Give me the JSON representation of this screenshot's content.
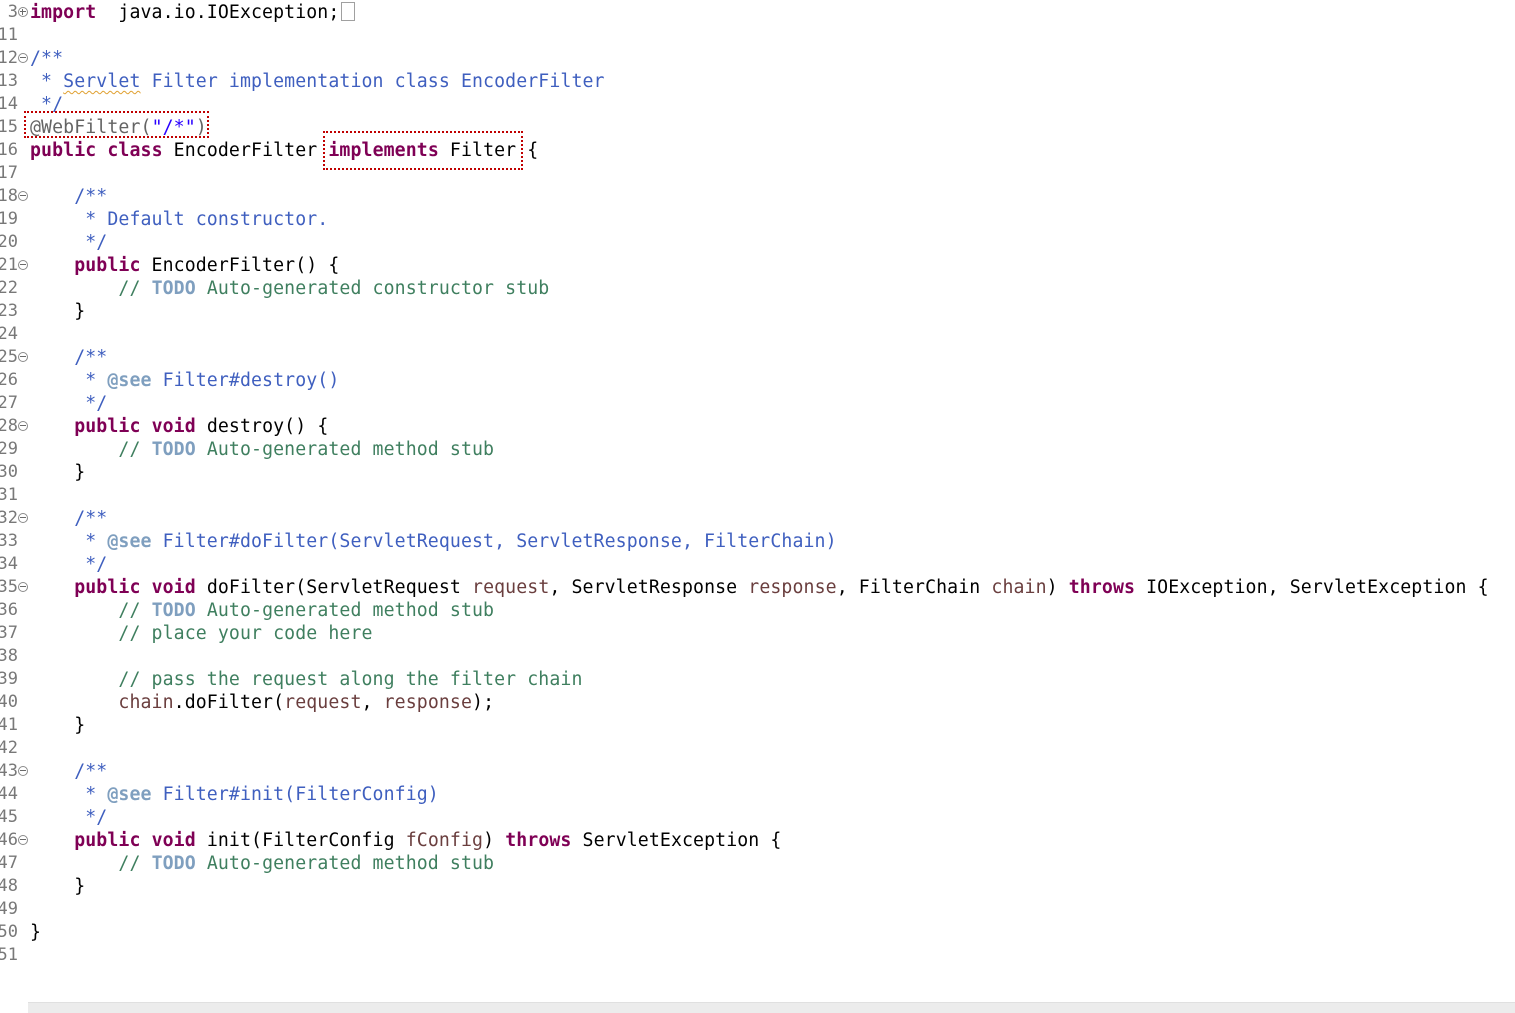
{
  "editor": {
    "language": "java",
    "highlight_color": "#c00000",
    "lines": [
      {
        "n": "3",
        "fold": "plus",
        "tokens": [
          [
            "kw",
            "import"
          ],
          [
            "",
            "  java.io.IOException;"
          ]
        ],
        "folded_marker": true
      },
      {
        "n": "11",
        "tokens": []
      },
      {
        "n": "12",
        "fold": "minus",
        "tokens": [
          [
            "cm",
            "/**"
          ]
        ]
      },
      {
        "n": "13",
        "tokens": [
          [
            "cm",
            " * "
          ],
          [
            "cm squig",
            "Servlet"
          ],
          [
            "cm",
            " Filter implementation class EncoderFilter"
          ]
        ]
      },
      {
        "n": "14",
        "tokens": [
          [
            "cm",
            " */"
          ]
        ]
      },
      {
        "n": "15",
        "tokens": [
          [
            "ann",
            "@WebFilter("
          ],
          [
            "str",
            "\"/*\""
          ],
          [
            "ann",
            ")"
          ]
        ]
      },
      {
        "n": "16",
        "tokens": [
          [
            "kw",
            "public"
          ],
          [
            "",
            " "
          ],
          [
            "kw",
            "class"
          ],
          [
            "",
            " EncoderFilter "
          ],
          [
            "kw",
            "implements"
          ],
          [
            "",
            " Filter {"
          ]
        ]
      },
      {
        "n": "17",
        "tokens": []
      },
      {
        "n": "18",
        "fold": "minus",
        "tokens": [
          [
            "cm",
            "    /**"
          ]
        ]
      },
      {
        "n": "19",
        "tokens": [
          [
            "cm",
            "     * Default constructor."
          ]
        ]
      },
      {
        "n": "20",
        "tokens": [
          [
            "cm",
            "     */"
          ]
        ]
      },
      {
        "n": "21",
        "fold": "minus",
        "tokens": [
          [
            "kw",
            "    public"
          ],
          [
            "",
            " EncoderFilter() {"
          ]
        ]
      },
      {
        "n": "22",
        "tokens": [
          [
            "lc",
            "        // "
          ],
          [
            "todo",
            "TODO"
          ],
          [
            "lc",
            " Auto-generated constructor stub"
          ]
        ]
      },
      {
        "n": "23",
        "tokens": [
          [
            "",
            "    }"
          ]
        ]
      },
      {
        "n": "24",
        "tokens": []
      },
      {
        "n": "25",
        "fold": "minus",
        "tokens": [
          [
            "cm",
            "    /**"
          ]
        ]
      },
      {
        "n": "26",
        "tokens": [
          [
            "cm",
            "     * "
          ],
          [
            "tag",
            "@see"
          ],
          [
            "cm",
            " Filter#destroy()"
          ]
        ]
      },
      {
        "n": "27",
        "tokens": [
          [
            "cm",
            "     */"
          ]
        ]
      },
      {
        "n": "28",
        "fold": "minus",
        "tokens": [
          [
            "kw",
            "    public"
          ],
          [
            "",
            " "
          ],
          [
            "kw",
            "void"
          ],
          [
            "",
            " destroy() {"
          ]
        ]
      },
      {
        "n": "29",
        "tokens": [
          [
            "lc",
            "        // "
          ],
          [
            "todo",
            "TODO"
          ],
          [
            "lc",
            " Auto-generated method stub"
          ]
        ]
      },
      {
        "n": "30",
        "tokens": [
          [
            "",
            "    }"
          ]
        ]
      },
      {
        "n": "31",
        "tokens": []
      },
      {
        "n": "32",
        "fold": "minus",
        "tokens": [
          [
            "cm",
            "    /**"
          ]
        ]
      },
      {
        "n": "33",
        "tokens": [
          [
            "cm",
            "     * "
          ],
          [
            "tag",
            "@see"
          ],
          [
            "cm",
            " Filter#doFilter(ServletRequest, ServletResponse, FilterChain)"
          ]
        ]
      },
      {
        "n": "34",
        "tokens": [
          [
            "cm",
            "     */"
          ]
        ]
      },
      {
        "n": "35",
        "fold": "minus",
        "tokens": [
          [
            "kw",
            "    public"
          ],
          [
            "",
            " "
          ],
          [
            "kw",
            "void"
          ],
          [
            "",
            " doFilter(ServletRequest "
          ],
          [
            "param",
            "request"
          ],
          [
            "",
            ", ServletResponse "
          ],
          [
            "param",
            "response"
          ],
          [
            "",
            ", FilterChain "
          ],
          [
            "param",
            "chain"
          ],
          [
            "",
            ") "
          ],
          [
            "kw",
            "throws"
          ],
          [
            "",
            " IOException, ServletException {"
          ]
        ]
      },
      {
        "n": "36",
        "tokens": [
          [
            "lc",
            "        // "
          ],
          [
            "todo",
            "TODO"
          ],
          [
            "lc",
            " Auto-generated method stub"
          ]
        ]
      },
      {
        "n": "37",
        "tokens": [
          [
            "lc",
            "        // place your code here"
          ]
        ]
      },
      {
        "n": "38",
        "tokens": []
      },
      {
        "n": "39",
        "tokens": [
          [
            "lc",
            "        // pass the request along the filter chain"
          ]
        ]
      },
      {
        "n": "40",
        "tokens": [
          [
            "param",
            "        chain"
          ],
          [
            "",
            ".doFilter("
          ],
          [
            "param",
            "request"
          ],
          [
            "",
            ", "
          ],
          [
            "param",
            "response"
          ],
          [
            "",
            ");"
          ]
        ]
      },
      {
        "n": "41",
        "tokens": [
          [
            "",
            "    }"
          ]
        ]
      },
      {
        "n": "42",
        "tokens": []
      },
      {
        "n": "43",
        "fold": "minus",
        "tokens": [
          [
            "cm",
            "    /**"
          ]
        ]
      },
      {
        "n": "44",
        "tokens": [
          [
            "cm",
            "     * "
          ],
          [
            "tag",
            "@see"
          ],
          [
            "cm",
            " Filter#init(FilterConfig)"
          ]
        ]
      },
      {
        "n": "45",
        "tokens": [
          [
            "cm",
            "     */"
          ]
        ]
      },
      {
        "n": "46",
        "fold": "minus",
        "tokens": [
          [
            "kw",
            "    public"
          ],
          [
            "",
            " "
          ],
          [
            "kw",
            "void"
          ],
          [
            "",
            " init(FilterConfig "
          ],
          [
            "param",
            "fConfig"
          ],
          [
            "",
            ") "
          ],
          [
            "kw",
            "throws"
          ],
          [
            "",
            " ServletException {"
          ]
        ]
      },
      {
        "n": "47",
        "tokens": [
          [
            "lc",
            "        // "
          ],
          [
            "todo",
            "TODO"
          ],
          [
            "lc",
            " Auto-generated method stub"
          ]
        ]
      },
      {
        "n": "48",
        "tokens": [
          [
            "",
            "    }"
          ]
        ]
      },
      {
        "n": "49",
        "tokens": []
      },
      {
        "n": "50",
        "tokens": [
          [
            "",
            "}"
          ]
        ]
      },
      {
        "n": "51",
        "tokens": []
      }
    ]
  }
}
